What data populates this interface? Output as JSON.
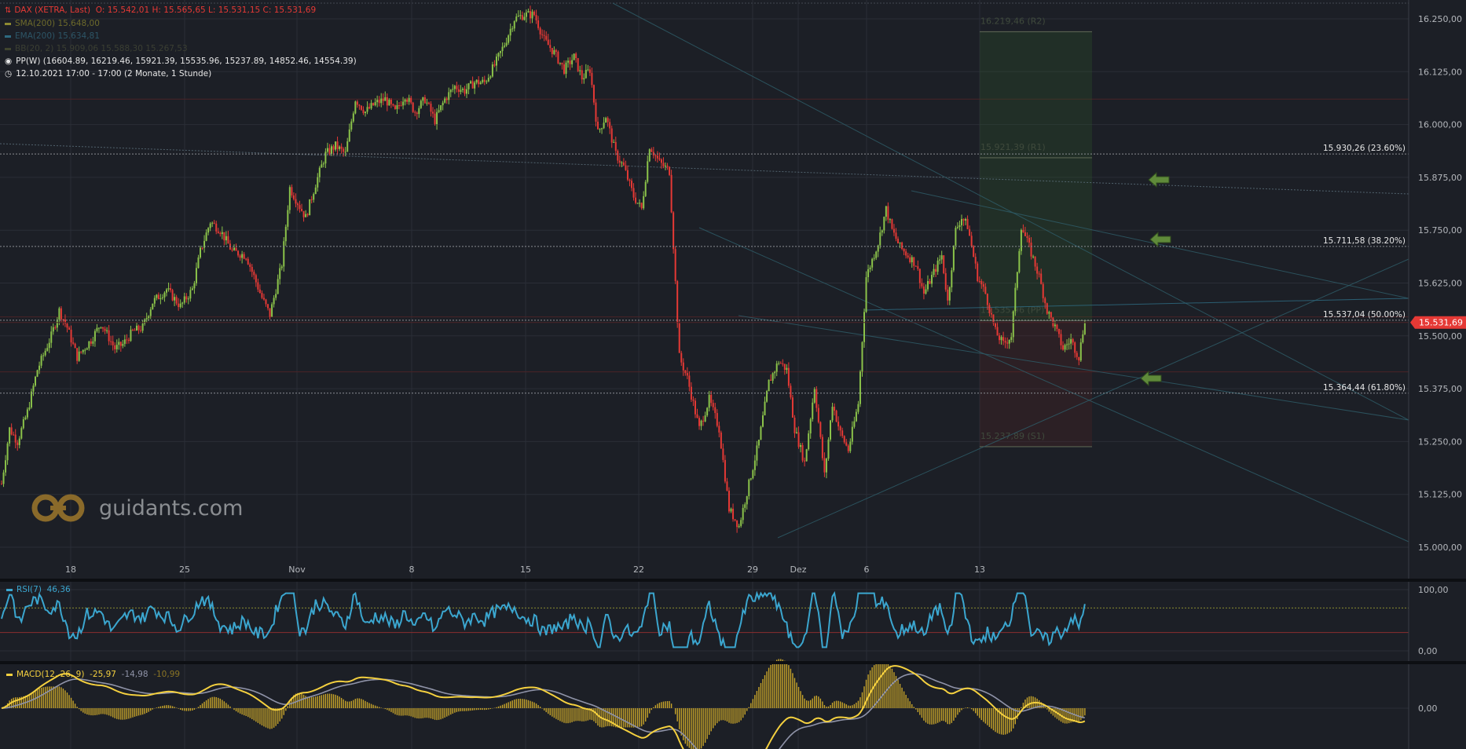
{
  "colors": {
    "background": "#1c1f26",
    "grid": "#2a2e37",
    "up": "#8bc34a",
    "down": "#e53935",
    "rsi": "#3ba6cf",
    "macd": "#f4d03f",
    "signal": "#8f93a8",
    "histogram": "#c8a52a",
    "axis_text": "#b4b7bc",
    "price_badge": "#e53935"
  },
  "legend": {
    "instrument": "DAX (XETRA, Last)",
    "ohlc": "O: 15.542,01  H: 15.565,65  L: 15.531,15  C: 15.531,69",
    "sma": "SMA(200)  15.648,00",
    "ema": "EMA(200)  15.634,81",
    "bb": "BB(20, 2)  15.909,06  15.588,30  15.267,53",
    "pivot": "PP(W)  (16604.89, 16219.46, 15921.39, 15535.96, 15237.89, 14852.46, 14554.39)",
    "period": "12.10.2021 17:00 - 17:00   (2 Monate, 1 Stunde)"
  },
  "price_axis": {
    "ticks": [
      "15.000,00",
      "15.125,00",
      "15.250,00",
      "15.375,00",
      "15.500,00",
      "15.625,00",
      "15.750,00",
      "15.875,00",
      "16.000,00",
      "16.125,00",
      "16.250,00"
    ],
    "current_price": "15.531,69"
  },
  "time_axis": {
    "ticks": [
      "18",
      "25",
      "Nov",
      "8",
      "15",
      "22",
      "29",
      "Dez",
      "6",
      "13"
    ]
  },
  "fib_levels": [
    {
      "label": "15.930,26 (23.60%)",
      "value": 15930.26
    },
    {
      "label": "15.711,58 (38.20%)",
      "value": 15711.58
    },
    {
      "label": "15.537,04 (50.00%)",
      "value": 15537.04
    },
    {
      "label": "15.364,44 (61.80%)",
      "value": 15364.44
    }
  ],
  "pivot_labels": [
    {
      "label": "16.219,46 (R2)",
      "value": 16219.46
    },
    {
      "label": "15.921,39 (R1)",
      "value": 15921.39
    },
    {
      "label": "15.535,96 (PP)",
      "value": 15535.96
    },
    {
      "label": "15.237,89 (S1)",
      "value": 15237.89
    }
  ],
  "rsi_panel": {
    "label": "RSI(7)",
    "value": "46,36",
    "ticks": [
      "0,00",
      "100,00"
    ],
    "upper_band": 70,
    "lower_band": 30
  },
  "macd_panel": {
    "label": "MACD(12, 26, 9)",
    "macd": "-25,97",
    "signal": "-14,98",
    "hist": "-10,99",
    "ticks": [
      "0,00"
    ]
  },
  "logo": {
    "text": "guidants.com"
  },
  "chart_data": {
    "type": "candlestick",
    "title": "DAX (XETRA, Last)",
    "ylim": [
      14950,
      16290
    ],
    "x_ticks": [
      "18",
      "25",
      "Nov",
      "8",
      "15",
      "22",
      "29",
      "Dez",
      "6",
      "13"
    ],
    "y_ticks": [
      15000,
      15125,
      15250,
      15375,
      15500,
      15625,
      15750,
      15875,
      16000,
      16125,
      16250
    ],
    "price_path": [
      [
        0,
        15150
      ],
      [
        4,
        15280
      ],
      [
        8,
        15250
      ],
      [
        13,
        15320
      ],
      [
        18,
        15420
      ],
      [
        25,
        15500
      ],
      [
        29,
        15560
      ],
      [
        33,
        15520
      ],
      [
        38,
        15450
      ],
      [
        45,
        15490
      ],
      [
        50,
        15530
      ],
      [
        57,
        15470
      ],
      [
        61,
        15480
      ],
      [
        66,
        15510
      ],
      [
        71,
        15520
      ],
      [
        76,
        15580
      ],
      [
        83,
        15610
      ],
      [
        90,
        15570
      ],
      [
        96,
        15610
      ],
      [
        100,
        15700
      ],
      [
        105,
        15770
      ],
      [
        110,
        15750
      ],
      [
        116,
        15700
      ],
      [
        123,
        15690
      ],
      [
        127,
        15640
      ],
      [
        131,
        15590
      ],
      [
        135,
        15550
      ],
      [
        141,
        15670
      ],
      [
        145,
        15850
      ],
      [
        153,
        15780
      ],
      [
        158,
        15860
      ],
      [
        163,
        15930
      ],
      [
        168,
        15950
      ],
      [
        173,
        15930
      ],
      [
        178,
        16060
      ],
      [
        183,
        16030
      ],
      [
        188,
        16050
      ],
      [
        193,
        16060
      ],
      [
        198,
        16030
      ],
      [
        203,
        16070
      ],
      [
        208,
        16030
      ],
      [
        213,
        16060
      ],
      [
        218,
        16010
      ],
      [
        223,
        16060
      ],
      [
        228,
        16090
      ],
      [
        233,
        16080
      ],
      [
        238,
        16100
      ],
      [
        243,
        16100
      ],
      [
        248,
        16140
      ],
      [
        253,
        16190
      ],
      [
        258,
        16250
      ],
      [
        263,
        16260
      ],
      [
        268,
        16260
      ],
      [
        273,
        16200
      ],
      [
        278,
        16170
      ],
      [
        283,
        16130
      ],
      [
        288,
        16160
      ],
      [
        292,
        16110
      ],
      [
        296,
        16130
      ],
      [
        300,
        15980
      ],
      [
        304,
        16020
      ],
      [
        309,
        15930
      ],
      [
        313,
        15900
      ],
      [
        318,
        15830
      ],
      [
        322,
        15800
      ],
      [
        326,
        15950
      ],
      [
        331,
        15910
      ],
      [
        336,
        15890
      ],
      [
        341,
        15450
      ],
      [
        345,
        15400
      ],
      [
        351,
        15280
      ],
      [
        356,
        15350
      ],
      [
        361,
        15280
      ],
      [
        366,
        15090
      ],
      [
        371,
        15050
      ],
      [
        376,
        15150
      ],
      [
        381,
        15250
      ],
      [
        386,
        15390
      ],
      [
        391,
        15440
      ],
      [
        395,
        15420
      ],
      [
        399,
        15280
      ],
      [
        404,
        15200
      ],
      [
        409,
        15380
      ],
      [
        414,
        15170
      ],
      [
        418,
        15340
      ],
      [
        422,
        15270
      ],
      [
        426,
        15230
      ],
      [
        431,
        15340
      ],
      [
        435,
        15640
      ],
      [
        441,
        15720
      ],
      [
        445,
        15800
      ],
      [
        448,
        15750
      ],
      [
        452,
        15710
      ],
      [
        456,
        15690
      ],
      [
        460,
        15670
      ],
      [
        464,
        15600
      ],
      [
        469,
        15650
      ],
      [
        473,
        15690
      ],
      [
        476,
        15580
      ],
      [
        480,
        15750
      ],
      [
        483,
        15780
      ],
      [
        486,
        15760
      ],
      [
        491,
        15640
      ],
      [
        495,
        15600
      ],
      [
        500,
        15510
      ],
      [
        504,
        15480
      ],
      [
        508,
        15500
      ],
      [
        513,
        15760
      ],
      [
        517,
        15710
      ],
      [
        522,
        15640
      ],
      [
        526,
        15560
      ],
      [
        530,
        15520
      ],
      [
        534,
        15470
      ],
      [
        538,
        15490
      ],
      [
        542,
        15450
      ],
      [
        545,
        15540
      ]
    ],
    "series": [
      {
        "name": "RSI(7)",
        "last": 46.36
      },
      {
        "name": "MACD(12, 26, 9)",
        "last": -25.97
      },
      {
        "name": "Signal",
        "last": -14.98
      },
      {
        "name": "Histogram",
        "last": -10.99
      }
    ]
  }
}
